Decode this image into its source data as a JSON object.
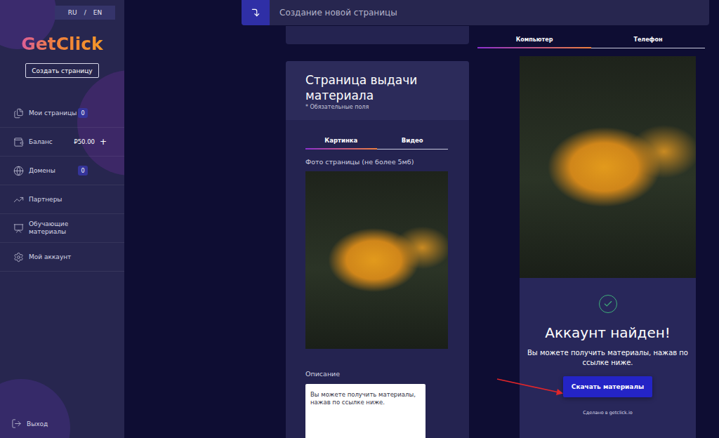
{
  "sidebar": {
    "language": {
      "options": [
        "RU",
        "EN"
      ],
      "separator": "/"
    },
    "logo": "GetClick",
    "create_button": "Создать страницу",
    "items": [
      {
        "label": "Мои страницы",
        "kind": "badge",
        "value": "0"
      },
      {
        "label": "Баланс",
        "kind": "value",
        "value": "₽50.00",
        "action": "+"
      },
      {
        "label": "Домены",
        "kind": "badge",
        "value": "0"
      },
      {
        "label": "Партнеры",
        "kind": "plain"
      },
      {
        "label": "Обучающие материалы",
        "kind": "plain"
      },
      {
        "label": "Мой аккаунт",
        "kind": "plain"
      }
    ],
    "logout": "Выход"
  },
  "topbar": {
    "title": "Создание новой страницы"
  },
  "form": {
    "title": "Страница выдачи материала",
    "required_note": "* Обязательные поля",
    "tabs": [
      {
        "label": "Картинка",
        "selected": true
      },
      {
        "label": "Видео",
        "selected": false
      }
    ],
    "photo_label": "Фото страницы (не более 5мб)",
    "description_label": "Описание",
    "description_value": "Вы можете получить материалы, нажав по ссылке ниже."
  },
  "preview": {
    "tabs": [
      {
        "label": "Компьютер",
        "selected": true
      },
      {
        "label": "Телефон",
        "selected": false
      }
    ],
    "heading": "Аккаунт найден!",
    "text": "Вы можете получить материалы, нажав по ссылке ниже.",
    "button": "Скачать материалы",
    "footer": "Сделано в getclick.io"
  }
}
